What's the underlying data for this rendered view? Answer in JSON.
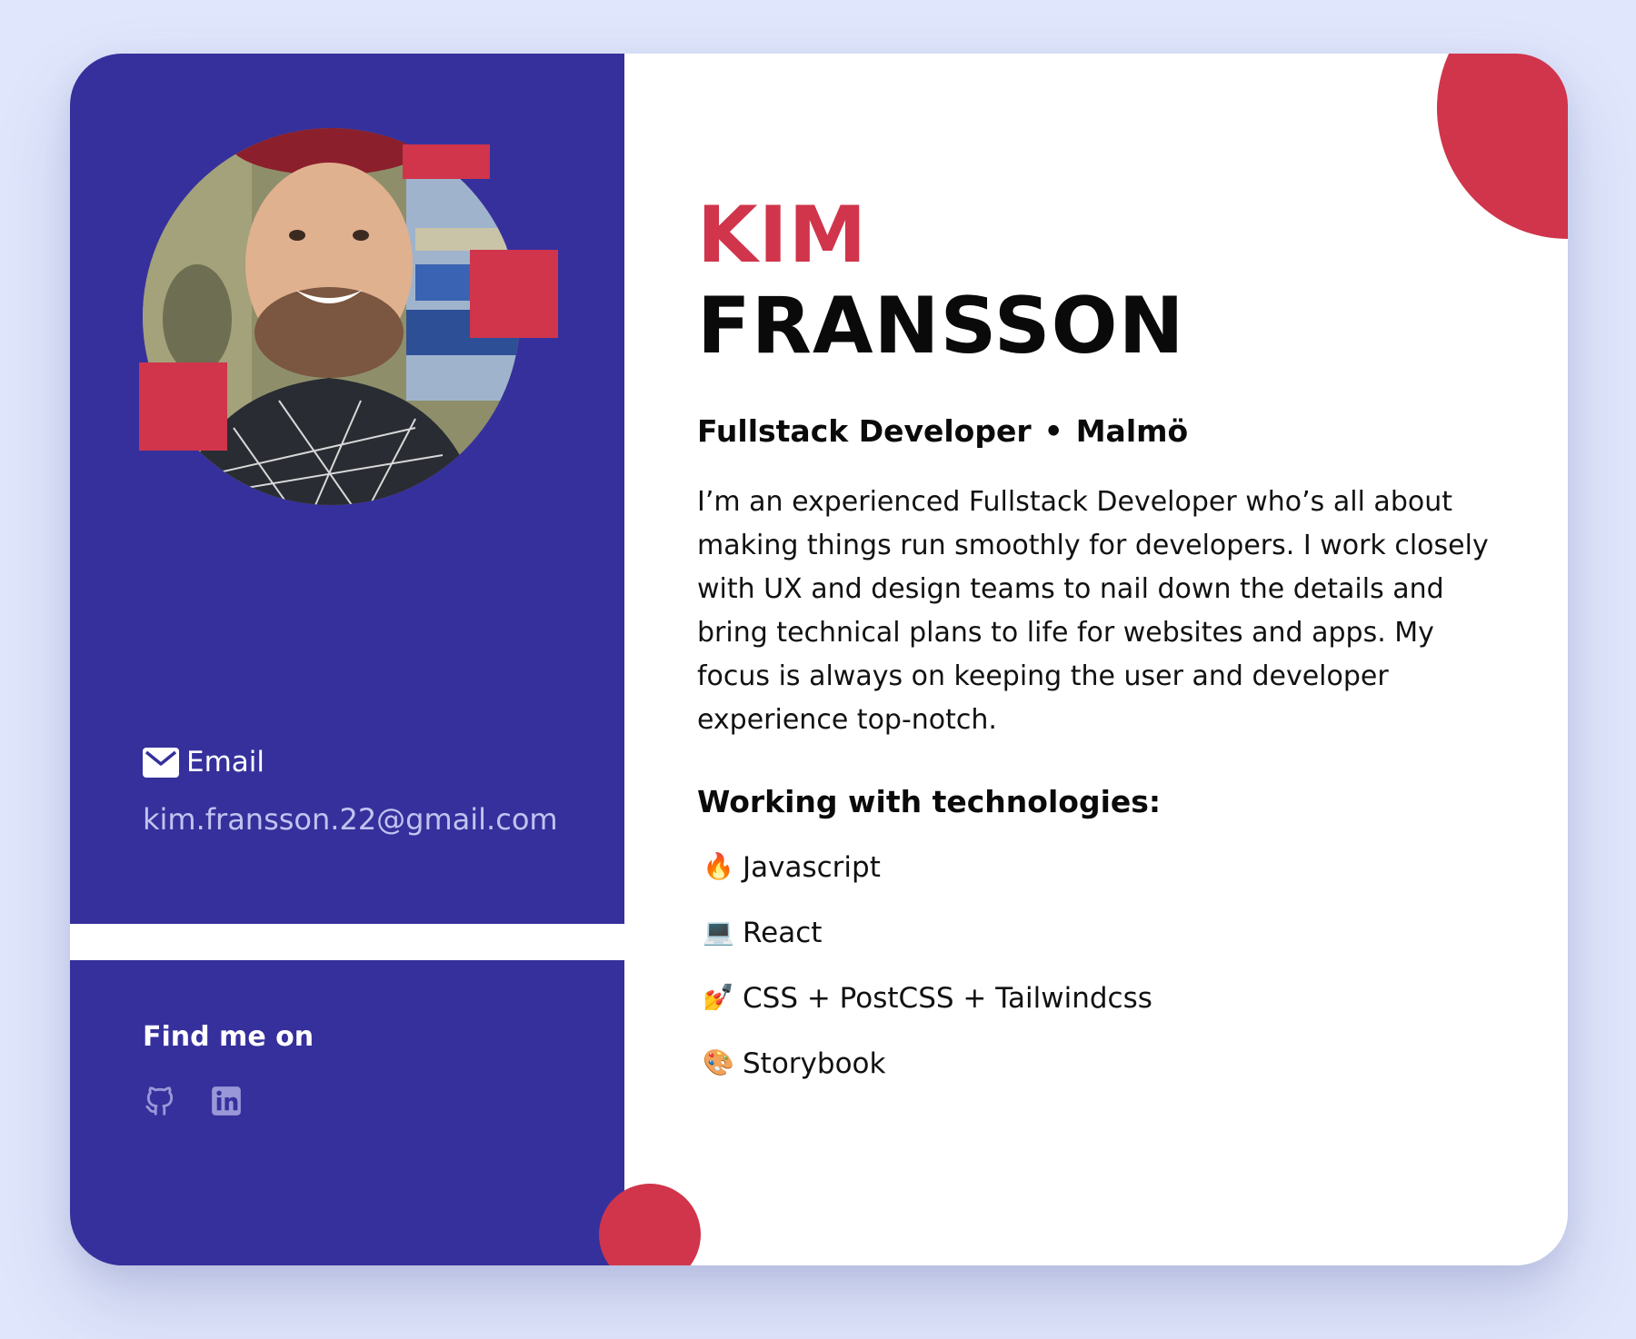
{
  "profile": {
    "first_name": "KIM",
    "last_name": "FRANSSON",
    "role": "Fullstack Developer",
    "separator": "•",
    "location": "Malmö",
    "bio": "I’m an experienced Fullstack Developer who’s all about making things run smoothly for developers. I work closely with UX and design teams to nail down the details and bring technical plans to life for websites and apps. My focus is always on keeping the user and developer experience top-notch."
  },
  "contact": {
    "email_label": "Email",
    "email_value": "kim.fransson.22@gmail.com",
    "email_icon": "envelope-icon"
  },
  "social": {
    "title": "Find me on",
    "links": [
      {
        "icon": "github-icon"
      },
      {
        "icon": "linkedin-icon"
      }
    ]
  },
  "technologies": {
    "title": "Working with technologies:",
    "items": [
      {
        "emoji": "🔥",
        "label": "Javascript"
      },
      {
        "emoji": "💻",
        "label": "React"
      },
      {
        "emoji": "💅",
        "label": "CSS + PostCSS + Tailwindcss"
      },
      {
        "emoji": "🎨",
        "label": "Storybook"
      }
    ]
  },
  "colors": {
    "page_background": "#e0e6fb",
    "sidebar": "#36309c",
    "accent": "#d0354b",
    "email_text": "#c1c3f0"
  }
}
